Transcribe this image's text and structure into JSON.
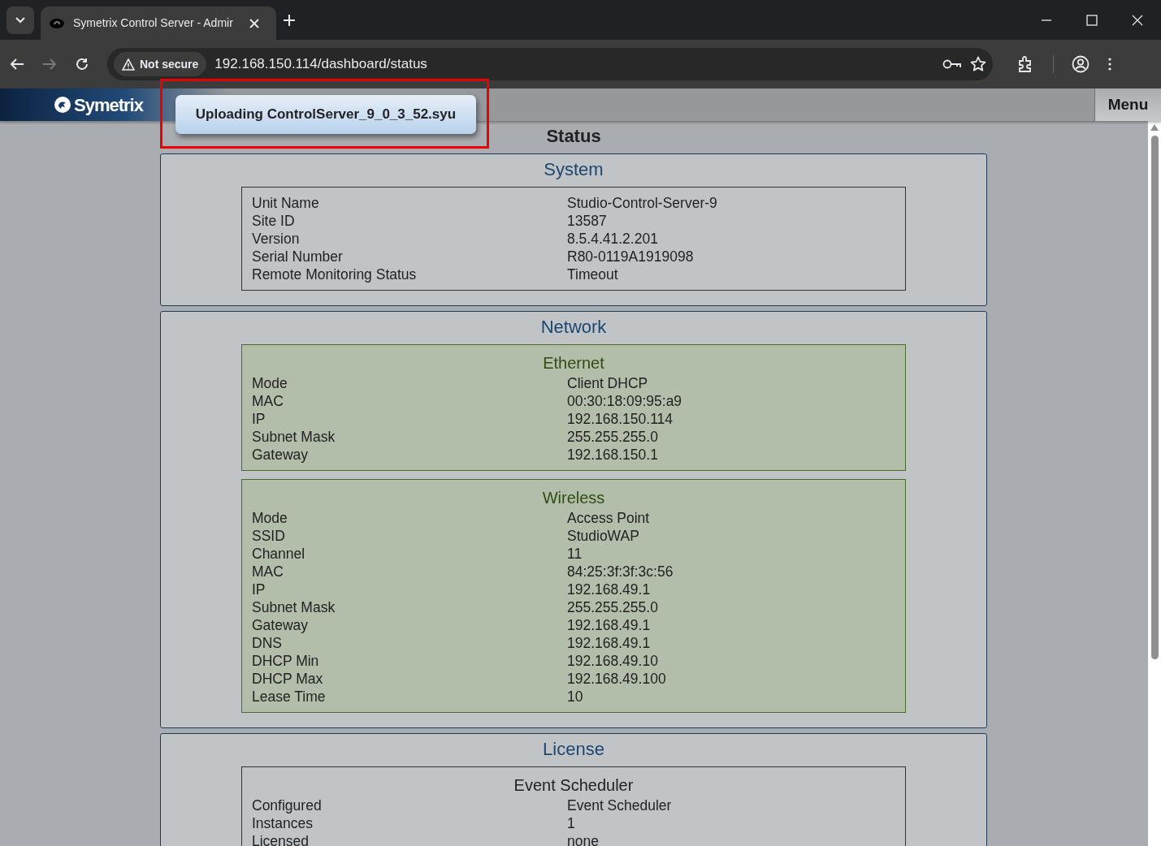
{
  "browser": {
    "tabs": [
      {
        "title": "Symetrix Control Server - Admir",
        "selected": true
      }
    ],
    "forward_disabled": true,
    "security": "Not secure",
    "url": "192.168.150.114/dashboard/status"
  },
  "app": {
    "logo": "Symetrix",
    "menu_button": "Menu",
    "toast": "Uploading ControlServer_9_0_3_52.syu",
    "toast_highlighted": true,
    "page_title": "Status"
  },
  "sections": [
    {
      "title": "System",
      "groups": [
        {
          "kind": "plain",
          "rows": [
            {
              "label": "Unit Name",
              "value": "Studio-Control-Server-9"
            },
            {
              "label": "Site ID",
              "value": "13587"
            },
            {
              "label": "Version",
              "value": "8.5.4.41.2.201"
            },
            {
              "label": "Serial Number",
              "value": "R80-0119A1919098"
            },
            {
              "label": "Remote Monitoring Status",
              "value": "Timeout"
            }
          ]
        }
      ]
    },
    {
      "title": "Network",
      "groups": [
        {
          "kind": "green",
          "title": "Ethernet",
          "rows": [
            {
              "label": "Mode",
              "value": "Client DHCP"
            },
            {
              "label": "MAC",
              "value": "00:30:18:09:95:a9"
            },
            {
              "label": "IP",
              "value": "192.168.150.114"
            },
            {
              "label": "Subnet Mask",
              "value": "255.255.255.0"
            },
            {
              "label": "Gateway",
              "value": "192.168.150.1"
            }
          ]
        },
        {
          "kind": "green",
          "title": "Wireless",
          "rows": [
            {
              "label": "Mode",
              "value": "Access Point"
            },
            {
              "label": "SSID",
              "value": "StudioWAP"
            },
            {
              "label": "Channel",
              "value": "11"
            },
            {
              "label": "MAC",
              "value": "84:25:3f:3f:3c:56"
            },
            {
              "label": "IP",
              "value": "192.168.49.1"
            },
            {
              "label": "Subnet Mask",
              "value": "255.255.255.0"
            },
            {
              "label": "Gateway",
              "value": "192.168.49.1"
            },
            {
              "label": "DNS",
              "value": "192.168.49.1"
            },
            {
              "label": "DHCP Min",
              "value": "192.168.49.10"
            },
            {
              "label": "DHCP Max",
              "value": "192.168.49.100"
            },
            {
              "label": "Lease Time",
              "value": "10"
            }
          ]
        }
      ]
    },
    {
      "title": "License",
      "groups": [
        {
          "kind": "plain",
          "title": "Event Scheduler",
          "rows": [
            {
              "label": "Configured",
              "value": "Event Scheduler"
            },
            {
              "label": "Instances",
              "value": "1"
            },
            {
              "label": "Licensed",
              "value": "none"
            }
          ]
        }
      ]
    }
  ]
}
